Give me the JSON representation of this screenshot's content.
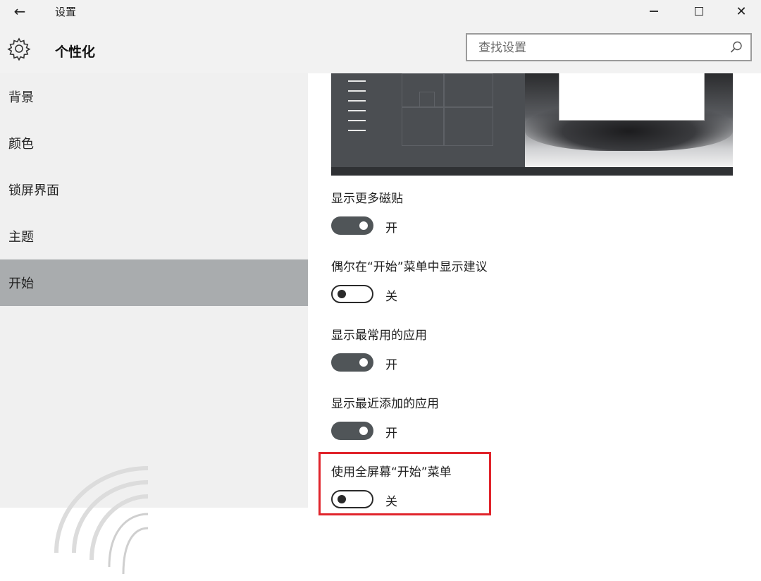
{
  "window": {
    "title": "设置",
    "back_icon": "arrow-left-icon",
    "min_icon": "minimize-icon",
    "max_icon": "maximize-icon",
    "close_icon": "close-icon",
    "close_glyph": "✕"
  },
  "header": {
    "icon": "gear-icon",
    "title": "个性化",
    "search_placeholder": "查找设置",
    "search_value": "",
    "search_icon": "search-icon"
  },
  "sidebar": {
    "items": [
      {
        "label": "背景",
        "active": false
      },
      {
        "label": "颜色",
        "active": false
      },
      {
        "label": "锁屏界面",
        "active": false
      },
      {
        "label": "主题",
        "active": false
      },
      {
        "label": "开始",
        "active": true
      }
    ],
    "active_color": "#a9acae"
  },
  "settings": [
    {
      "title": "显示更多磁贴",
      "state": "开",
      "on": true
    },
    {
      "title": "偶尔在“开始”菜单中显示建议",
      "state": "关",
      "on": false
    },
    {
      "title": "显示最常用的应用",
      "state": "开",
      "on": true
    },
    {
      "title": "显示最近添加的应用",
      "state": "开",
      "on": true
    },
    {
      "title": "使用全屏幕“开始”菜单",
      "state": "关",
      "on": false
    }
  ],
  "colors": {
    "toggle_on": "#505558",
    "highlight_border": "#e0242b"
  }
}
